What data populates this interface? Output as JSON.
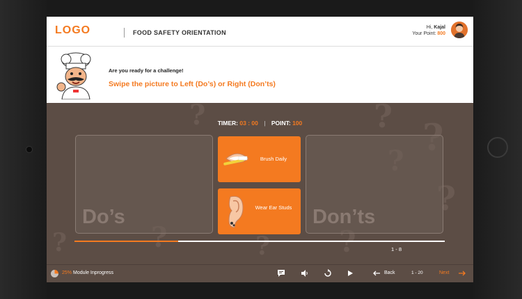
{
  "header": {
    "logo": "LOGO",
    "course_title": "FOOD SAFETY ORIENTATION",
    "greeting": "Hi,",
    "user_name": "Kajal",
    "points_label": "Your Point:",
    "points_value": "800"
  },
  "challenge": {
    "prompt": "Are you ready for a challenge!",
    "instruction": "Swipe the picture to Left (Do’s) or Right (Don’ts)"
  },
  "status": {
    "timer_label": "TIMER:",
    "timer_value": "03 : 00",
    "separator": "|",
    "point_label": "POINT:",
    "point_value": "100"
  },
  "zones": {
    "left": "Do’s",
    "right": "Don’ts"
  },
  "cards": [
    {
      "label": "Brush Daily"
    },
    {
      "label": "Wear Ear Studs"
    }
  ],
  "progress": {
    "fraction": 0.28,
    "count": "1 - 8"
  },
  "footer": {
    "module_percent": "25%",
    "module_status": "Module Inprogress",
    "back_label": "Back",
    "page_range": "1 - 20",
    "next_label": "Next"
  },
  "colors": {
    "accent": "#f47a20",
    "background": "#5c4d45"
  }
}
